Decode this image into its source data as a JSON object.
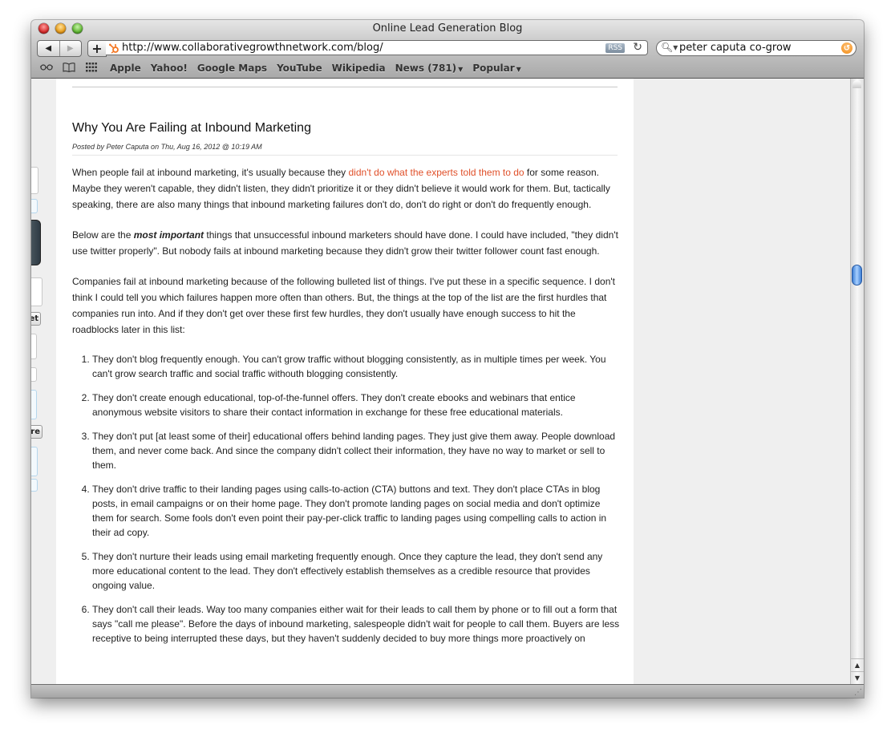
{
  "window": {
    "title": "Online Lead Generation Blog"
  },
  "toolbar": {
    "back_icon": "◀",
    "forward_icon": "▶",
    "add_icon": "+",
    "url": "http://www.collaborativegrowthnetwork.com/blog/",
    "rss_label": "RSS",
    "reload_icon": "↻",
    "search_value": "peter caputa co-grow",
    "search_icon": "🔍︎▾",
    "snapback_icon": "↺"
  },
  "bookmarks": {
    "icons": [
      "reading-list",
      "bookmarks-book",
      "top-sites-grid"
    ],
    "items": [
      {
        "label": "Apple"
      },
      {
        "label": "Yahoo!"
      },
      {
        "label": "Google Maps"
      },
      {
        "label": "YouTube"
      },
      {
        "label": "Wikipedia"
      },
      {
        "label": "News (781)",
        "has_menu": true
      },
      {
        "label": "Popular",
        "has_menu": true
      }
    ]
  },
  "sidebar_fragments": {
    "button_1": "et",
    "button_2": "re"
  },
  "post": {
    "title": "Why You Are Failing at Inbound Marketing",
    "meta": "Posted by Peter Caputa on Thu, Aug 16, 2012 @ 10:19 AM",
    "p1_before": "When people fail at inbound marketing, it's usually because they ",
    "p1_link": "didn't do what the experts told them to do",
    "p1_after": " for some reason. Maybe they weren't capable, they didn't listen, they didn't prioritize it or they didn't believe it would work for them. But, tactically speaking, there are also many things that inbound marketing failures don't do, don't do right or don't do frequently enough.",
    "p2_before": "Below are the ",
    "p2_emph": "most important",
    "p2_after": " things that unsuccessful inbound marketers should have done. I could have included, \"they didn't use twitter properly\". But nobody fails at inbound marketing because they didn't grow their twitter follower count fast enough.",
    "p3": "Companies fail at inbound marketing because of the following bulleted list of things. I've put these in a specific sequence. I don't think I could tell you which failures happen more often than others. But, the things at the top of the list are the first hurdles that companies run into. And if they don't get over these first few hurdles, they don't usually have enough success to hit the roadblocks later in this list:",
    "list": [
      "They don't blog frequently enough. You can't grow traffic without blogging consistently, as in multiple times per week. You can't grow search traffic and social traffic withouth blogging consistently.",
      "They don't create enough educational, top-of-the-funnel offers. They don't create ebooks and webinars that entice anonymous website visitors to share their contact information in exchange for these free educational materials.",
      "They don't put [at least some of their] educational offers behind landing pages. They just give them away. People download them, and never come back. And since the company didn't collect their information, they have no way to market or sell to them.",
      "They don't drive traffic to their landing pages using calls-to-action (CTA) buttons and text. They don't place CTAs in blog posts, in email campaigns or on their home page. They don't promote landing pages on social media and don't optimize them for search. Some fools don't even point their pay-per-click traffic to landing pages using compelling calls to action in their ad copy.",
      "They don't nurture their leads using email marketing frequently enough. Once they capture the lead, they don't send any more educational content to the lead. They don't effectively establish themselves as a credible resource that provides ongoing value.",
      "They don't call their leads. Way too many companies either wait for their leads to call them by phone or to fill out a form that says \"call me please\". Before the days of inbound marketing, salespeople didn't wait for people to call them. Buyers are less receptive to being interrupted these days, but they haven't suddenly decided to buy more things more proactively on"
    ]
  },
  "scrollbar": {
    "up_icon": "▲",
    "down_icon": "▼",
    "scroll_position": 0.3
  },
  "colors": {
    "link": "#e0502a",
    "accent_hubspot": "#f57722"
  }
}
